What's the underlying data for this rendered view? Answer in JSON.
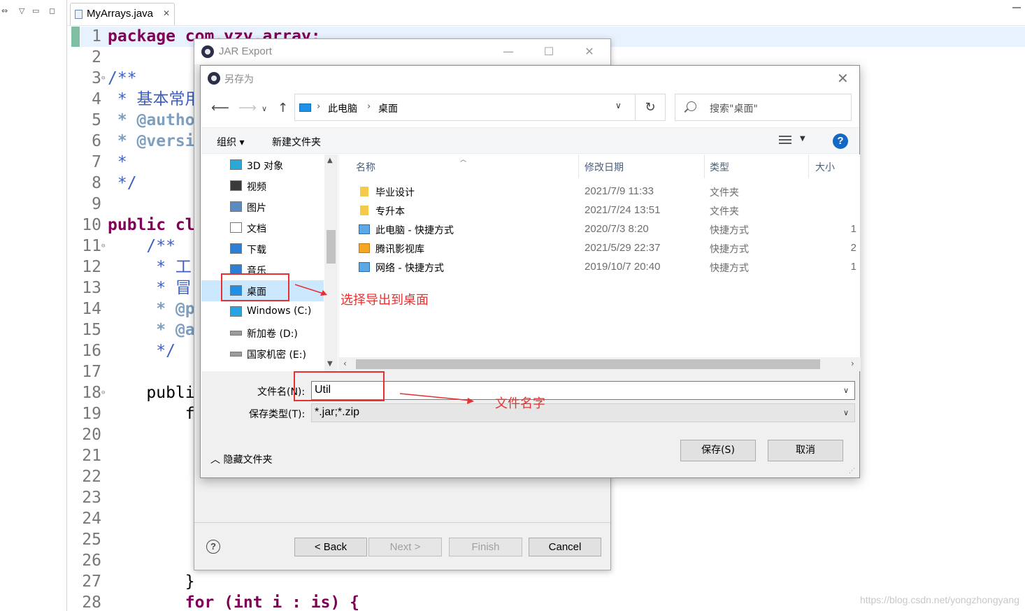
{
  "editor": {
    "tab_title": "MyArrays.java",
    "tab_close": "✕",
    "lines": [
      {
        "n": "1",
        "fold": "",
        "text": "package com.yzy.array;"
      },
      {
        "n": "2",
        "fold": "",
        "text": ""
      },
      {
        "n": "3",
        "fold": "⊖",
        "text": "/**"
      },
      {
        "n": "4",
        "fold": "",
        "text": " * 基本常用"
      },
      {
        "n": "5",
        "fold": "",
        "text": " * @autho"
      },
      {
        "n": "6",
        "fold": "",
        "text": " * @versi"
      },
      {
        "n": "7",
        "fold": "",
        "text": " *"
      },
      {
        "n": "8",
        "fold": "",
        "text": " */"
      },
      {
        "n": "9",
        "fold": "",
        "text": ""
      },
      {
        "n": "10",
        "fold": "",
        "text": "public cl"
      },
      {
        "n": "11",
        "fold": "⊖",
        "text": "    /**"
      },
      {
        "n": "12",
        "fold": "",
        "text": "     * 工"
      },
      {
        "n": "13",
        "fold": "",
        "text": "     * 冒"
      },
      {
        "n": "14",
        "fold": "",
        "text": "     * @p"
      },
      {
        "n": "15",
        "fold": "",
        "text": "     * @a"
      },
      {
        "n": "16",
        "fold": "",
        "text": "     */"
      },
      {
        "n": "17",
        "fold": "",
        "text": ""
      },
      {
        "n": "18",
        "fold": "⊖",
        "text": "    publi"
      },
      {
        "n": "19",
        "fold": "",
        "text": "        f"
      },
      {
        "n": "20",
        "fold": "",
        "text": ""
      },
      {
        "n": "21",
        "fold": "",
        "text": ""
      },
      {
        "n": "22",
        "fold": "",
        "text": ""
      },
      {
        "n": "23",
        "fold": "",
        "text": ""
      },
      {
        "n": "24",
        "fold": "",
        "text": ""
      },
      {
        "n": "25",
        "fold": "",
        "text": ""
      },
      {
        "n": "26",
        "fold": "",
        "text": ""
      },
      {
        "n": "27",
        "fold": "",
        "text": "        }"
      },
      {
        "n": "28",
        "fold": "",
        "text": "        for (int i : is) {"
      }
    ]
  },
  "jar_window": {
    "title": "JAR Export",
    "minimize": "—",
    "maximize": "☐",
    "close": "✕",
    "help": "?",
    "back": "< Back",
    "next": "Next >",
    "finish": "Finish",
    "cancel": "Cancel"
  },
  "save_dialog": {
    "title": "另存为",
    "close": "✕",
    "breadcrumb": [
      "此电脑",
      "桌面"
    ],
    "search_placeholder": "搜索\"桌面\"",
    "organize": "组织 ▾",
    "new_folder": "新建文件夹",
    "nav_items": [
      {
        "label": "3D 对象",
        "icon": "3d-objects-icon"
      },
      {
        "label": "视频",
        "icon": "video-icon"
      },
      {
        "label": "图片",
        "icon": "pictures-icon"
      },
      {
        "label": "文档",
        "icon": "documents-icon"
      },
      {
        "label": "下载",
        "icon": "downloads-icon"
      },
      {
        "label": "音乐",
        "icon": "music-icon"
      },
      {
        "label": "桌面",
        "icon": "desktop-icon",
        "selected": true
      },
      {
        "label": "Windows (C:)",
        "icon": "windows-drive-icon"
      },
      {
        "label": "新加卷 (D:)",
        "icon": "drive-icon"
      },
      {
        "label": "国家机密 (E:)",
        "icon": "drive-icon"
      }
    ],
    "columns": [
      "名称",
      "修改日期",
      "类型",
      "大小"
    ],
    "files": [
      {
        "name": "毕业设计",
        "date": "2021/7/9 11:33",
        "type": "文件夹",
        "size": "",
        "icon": "folder-icon"
      },
      {
        "name": "专升本",
        "date": "2021/7/24 13:51",
        "type": "文件夹",
        "size": "",
        "icon": "folder-icon"
      },
      {
        "name": "此电脑 - 快捷方式",
        "date": "2020/7/3 8:20",
        "type": "快捷方式",
        "size": "1",
        "icon": "pc-shortcut-icon"
      },
      {
        "name": "腾讯影视库",
        "date": "2021/5/29 22:37",
        "type": "快捷方式",
        "size": "2",
        "icon": "tencent-video-icon"
      },
      {
        "name": "网络 - 快捷方式",
        "date": "2019/10/7 20:40",
        "type": "快捷方式",
        "size": "1",
        "icon": "network-shortcut-icon"
      }
    ],
    "filename_label": "文件名(N):",
    "filename_value": "Util",
    "filetype_label": "保存类型(T):",
    "filetype_value": "*.jar;*.zip",
    "hide_folders": "隐藏文件夹",
    "save": "保存(S)",
    "cancel": "取消"
  },
  "annotations": {
    "desktop_note": "选择导出到桌面",
    "filename_note": "文件名字",
    "color": "#e83030"
  },
  "watermark": "https://blog.csdn.net/yongzhongyang"
}
